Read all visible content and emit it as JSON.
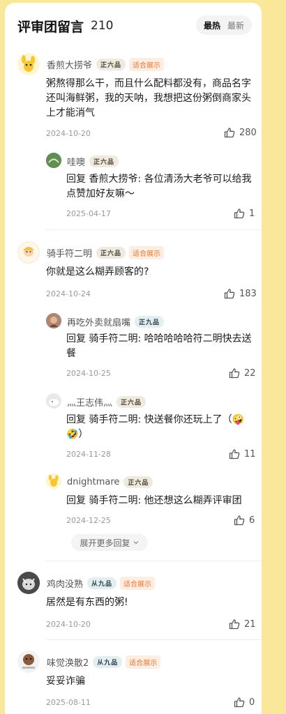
{
  "header": {
    "title": "评审团留言",
    "count": "210",
    "sort_hot": "最热",
    "sort_new": "最新"
  },
  "comments": [
    {
      "user": "香煎大捞爷",
      "badge": "正六品",
      "tag": "适合展示",
      "text": "粥熬得那么干，而且什么配料都没有，商品名字还叫海鲜粥，我的天呐，我想把这份粥倒商家头上才能消气",
      "date": "2024-10-20",
      "likes": "280",
      "replies": [
        {
          "user": "哇噢",
          "badge": "正六品",
          "reply_to": "回复  香煎大捞爷:",
          "text": "各位清汤大老爷可以给我点赞加好友嘛～",
          "date": "2025-04-17",
          "likes": "1"
        }
      ]
    },
    {
      "user": "骑手符二明",
      "badge": "正六品",
      "tag": "适合展示",
      "text": "你就是这么糊弄顾客的?",
      "date": "2024-10-24",
      "likes": "183",
      "replies": [
        {
          "user": "再吃外卖就扇嘴",
          "badge": "正九品",
          "reply_to": "回复  骑手符二明:",
          "text": "哈哈哈哈哈符二明快去送餐",
          "date": "2024-10-25",
          "likes": "22"
        },
        {
          "user": "灬王志伟灬",
          "badge": "正六品",
          "reply_to": "回复  骑手符二明:",
          "text": "快送餐你还玩上了（🤪🤣）",
          "date": "2024-11-28",
          "likes": "11"
        },
        {
          "user": "dnightmare",
          "badge": "正六品",
          "reply_to": "回复  骑手符二明:",
          "text": "他还想这么糊弄评审团",
          "date": "2024-12-25",
          "likes": "6"
        }
      ],
      "expand_label": "展开更多回复"
    },
    {
      "user": "鸡肉没熟",
      "badge": "从九品",
      "tag": "适合展示",
      "text": "居然是有东西的粥!",
      "date": "2024-10-20",
      "likes": "21"
    },
    {
      "user": "味觉涣散2",
      "badge": "从九品",
      "tag": "适合展示",
      "text": "妥妥诈骗",
      "date": "2025-08-11",
      "likes": "0"
    }
  ],
  "colors": {
    "background": "#f9e79a",
    "tag_text": "#e8782f",
    "tag_bg": "#fdeee4"
  }
}
